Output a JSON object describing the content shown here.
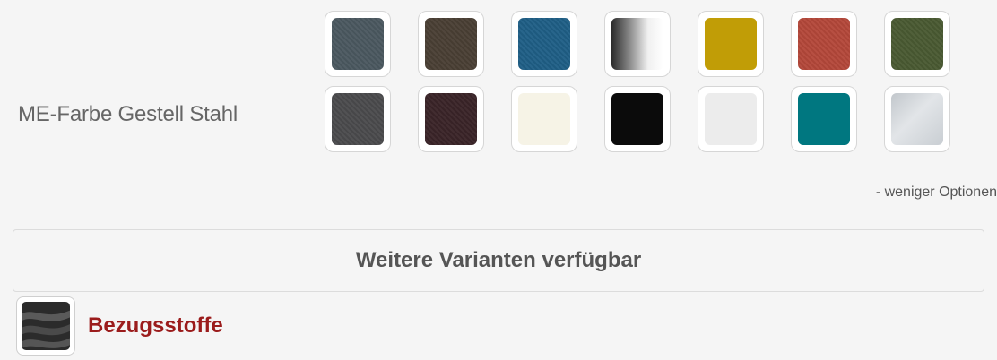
{
  "option": {
    "label": "ME-Farbe Gestell Stahl",
    "swatches": [
      {
        "color": "#4b5860",
        "style": "textured"
      },
      {
        "color": "#4a3f34",
        "style": "textured"
      },
      {
        "color": "#1f5f86",
        "style": "textured"
      },
      {
        "color": "#8a8a8a",
        "style": "grad-white"
      },
      {
        "color": "#c19d06",
        "style": "plain"
      },
      {
        "color": "#b4483a",
        "style": "textured"
      },
      {
        "color": "#4a5a32",
        "style": "textured"
      },
      {
        "color": "#4b4b4d",
        "style": "textured"
      },
      {
        "color": "#3a2428",
        "style": "textured"
      },
      {
        "color": "#f6f3e6",
        "style": "plain"
      },
      {
        "color": "#0b0b0b",
        "style": "plain"
      },
      {
        "color": "#ececec",
        "style": "plain"
      },
      {
        "color": "#007780",
        "style": "plain"
      },
      {
        "color": "#d3d6d9",
        "style": "metal"
      }
    ]
  },
  "less_options_label": "- weniger Optionen",
  "variants_label": "Weitere Varianten verfügbar",
  "fabric": {
    "label": "Bezugsstoffe",
    "icon": "fabric-texture-icon"
  },
  "colors": {
    "accent": "#9b1c1c",
    "text": "#555555",
    "background": "#f5f5f5"
  }
}
